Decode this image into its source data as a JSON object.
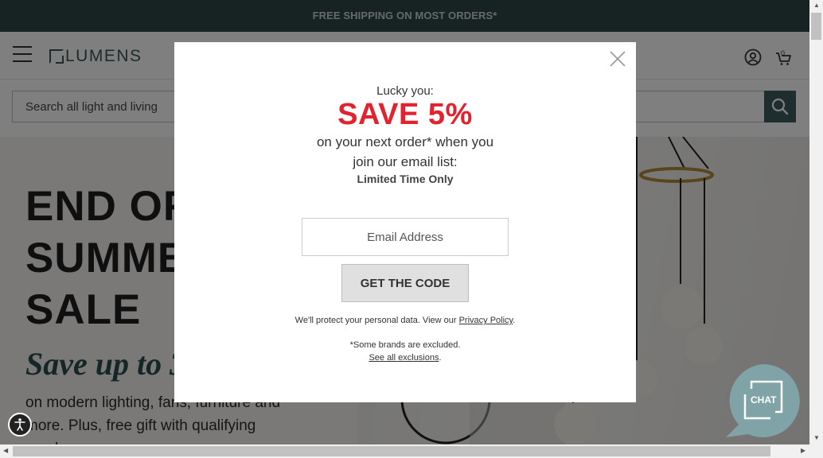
{
  "promo": {
    "text": "FREE SHIPPING ON MOST ORDERS*"
  },
  "header": {
    "logo_text": "LUMENS",
    "cart_count": "0"
  },
  "search": {
    "placeholder": "Search all light and living"
  },
  "hero": {
    "title_lines": [
      "END OF",
      "SUMMER",
      "SALE"
    ],
    "subtitle": "Save up to 30%",
    "body": "on modern lighting, fans, furniture and more. Plus, free gift with qualifying purchase."
  },
  "modal": {
    "intro": "Lucky you:",
    "headline": "SAVE 5%",
    "line1": "on your next order* when you",
    "line2": "join our email list:",
    "limited": "Limited Time Only",
    "email_placeholder": "Email Address",
    "button_label": "GET THE CODE",
    "privacy_prefix": "We'll protect your personal data. View our ",
    "privacy_link": "Privacy Policy",
    "privacy_suffix": ".",
    "excluded_note": "*Some brands are excluded.",
    "exclusions_link": "See all exclusions",
    "exclusions_suffix": "."
  },
  "chat": {
    "label": "CHAT"
  },
  "colors": {
    "promo_bg": "#2f4747",
    "headline": "#e3222d",
    "accent": "#3d5a5d",
    "chat": "#7fa3a7"
  }
}
